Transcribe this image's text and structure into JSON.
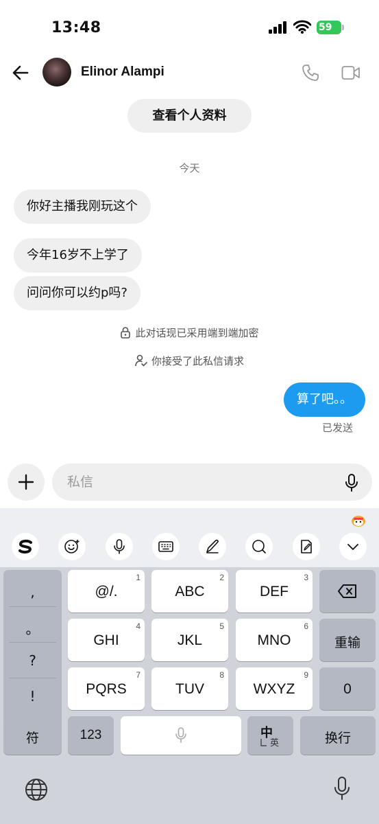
{
  "status_bar": {
    "time": "13:48",
    "battery": "59"
  },
  "header": {
    "contact_name": "Elinor Alampi"
  },
  "profile_button": "查看个人资料",
  "day_label": "今天",
  "messages_in": [
    "你好主播我刚玩这个",
    "今年16岁不上学了",
    "问问你可以约p吗?"
  ],
  "system_notes": [
    "此对话现已采用端到端加密",
    "你接受了此私信请求"
  ],
  "message_out": "算了吧。。",
  "sent_status": "已发送",
  "composer": {
    "placeholder": "私信"
  },
  "keyboard": {
    "punctuation": [
      ",",
      "。",
      "?",
      "!"
    ],
    "rows": [
      [
        {
          "label": "@/.",
          "num": "1"
        },
        {
          "label": "ABC",
          "num": "2"
        },
        {
          "label": "DEF",
          "num": "3"
        }
      ],
      [
        {
          "label": "GHI",
          "num": "4"
        },
        {
          "label": "JKL",
          "num": "5"
        },
        {
          "label": "MNO",
          "num": "6"
        }
      ],
      [
        {
          "label": "PQRS",
          "num": "7"
        },
        {
          "label": "TUV",
          "num": "8"
        },
        {
          "label": "WXYZ",
          "num": "9"
        }
      ]
    ],
    "reset_label": "重输",
    "zero_label": "0",
    "symbols_label": "符",
    "numbers_label": "123",
    "lang_main": "中",
    "lang_alt": "英",
    "enter_label": "换行"
  },
  "colors": {
    "accent": "#1d9bf0",
    "battery": "#34c759",
    "bubble_in": "#efefef",
    "keyboard_bg": "#d1d3da"
  }
}
